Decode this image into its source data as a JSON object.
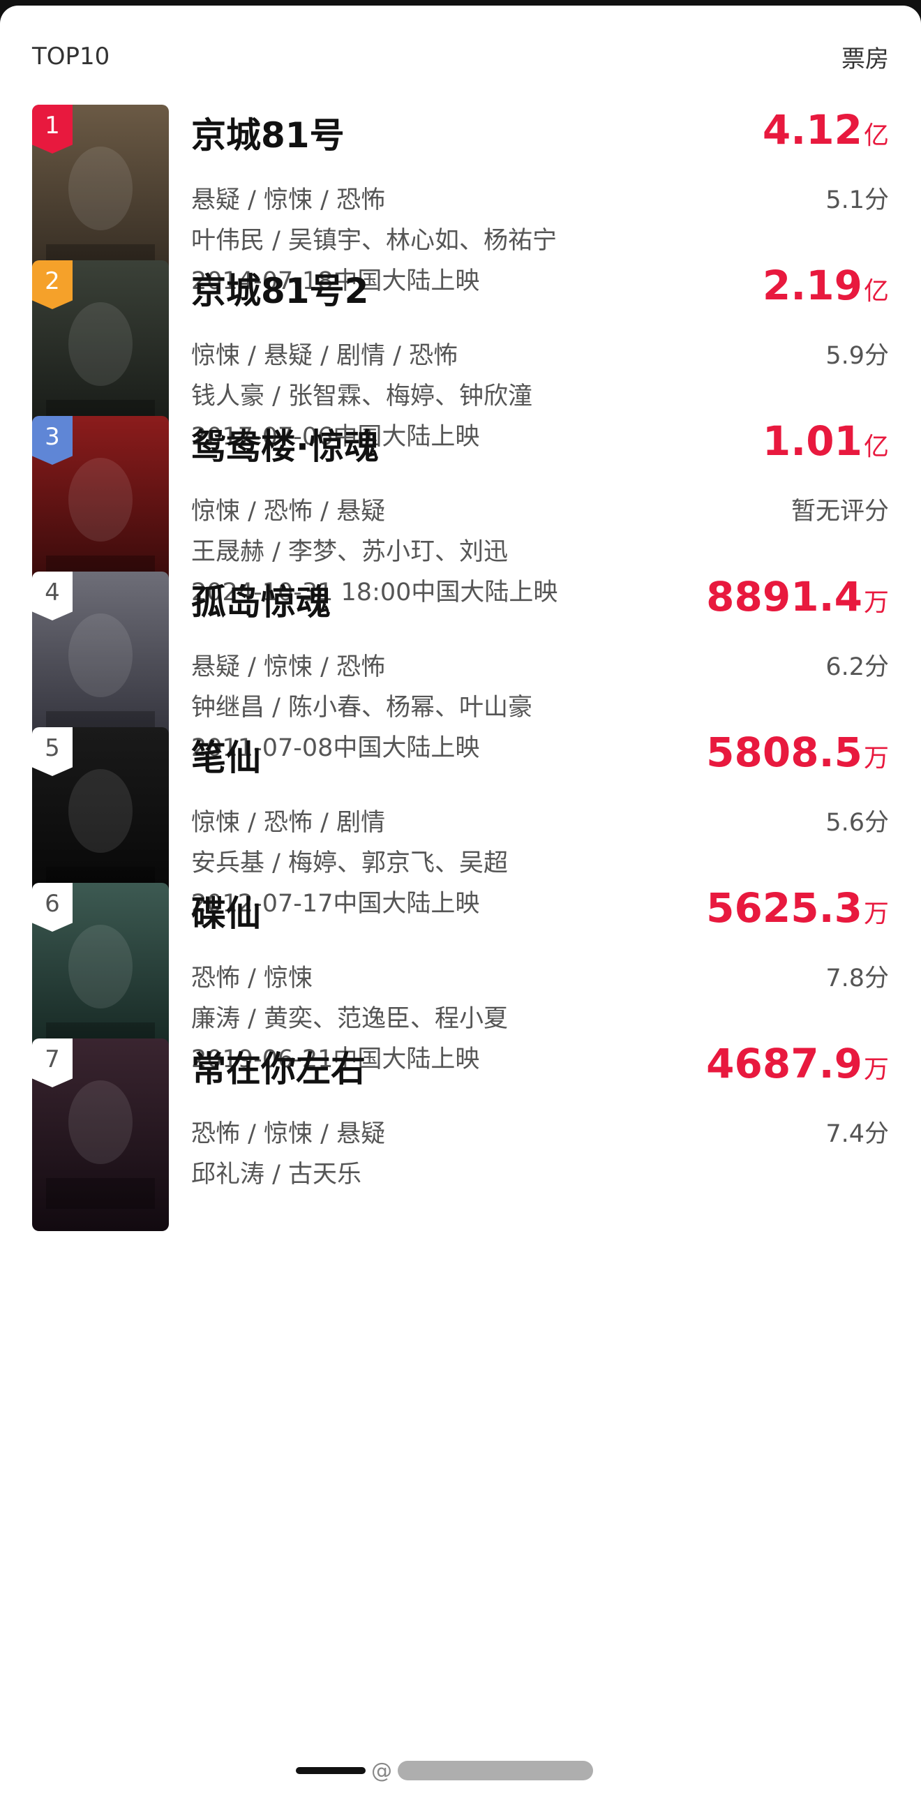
{
  "header": {
    "title": "TOP10",
    "right_label": "票房"
  },
  "movies": [
    {
      "rank": "1",
      "title": "京城81号",
      "box_num": "4.12",
      "box_unit": "亿",
      "genres": "悬疑 / 惊悚 / 恐怖",
      "score": "5.1分",
      "crew": "叶伟民 / 吴镇宇、林心如、杨祐宁",
      "release": "2014-07-18中国大陆上映",
      "poster_colors": [
        "#6b5a45",
        "#2d261e"
      ]
    },
    {
      "rank": "2",
      "title": "京城81号2",
      "box_num": "2.19",
      "box_unit": "亿",
      "genres": "惊悚 / 悬疑 / 剧情 / 恐怖",
      "score": "5.9分",
      "crew": "钱人豪 / 张智霖、梅婷、钟欣潼",
      "release": "2017-07-06中国大陆上映",
      "poster_colors": [
        "#3b4138",
        "#121512"
      ]
    },
    {
      "rank": "3",
      "title": "鸳鸯楼·惊魂",
      "box_num": "1.01",
      "box_unit": "亿",
      "genres": "惊悚 / 恐怖 / 悬疑",
      "score": "暂无评分",
      "crew": "王晟赫 / 李梦、苏小玎、刘迅",
      "release": "2024-10-31 18:00中国大陆上映",
      "poster_colors": [
        "#8c1c1c",
        "#2a0808"
      ]
    },
    {
      "rank": "4",
      "title": "孤岛惊魂",
      "box_num": "8891.4",
      "box_unit": "万",
      "genres": "悬疑 / 惊悚 / 恐怖",
      "score": "6.2分",
      "crew": "钟继昌 / 陈小春、杨幂、叶山豪",
      "release": "2011-07-08中国大陆上映",
      "poster_colors": [
        "#6e6e78",
        "#2a2a33"
      ]
    },
    {
      "rank": "5",
      "title": "笔仙",
      "box_num": "5808.5",
      "box_unit": "万",
      "genres": "惊悚 / 恐怖 / 剧情",
      "score": "5.6分",
      "crew": "安兵基 / 梅婷、郭京飞、吴超",
      "release": "2012-07-17中国大陆上映",
      "poster_colors": [
        "#1a1a1a",
        "#050505"
      ]
    },
    {
      "rank": "6",
      "title": "碟仙",
      "box_num": "5625.3",
      "box_unit": "万",
      "genres": "恐怖 / 惊悚",
      "score": "7.8分",
      "crew": "廉涛 / 黄奕、范逸臣、程小夏",
      "release": "2019-06-21中国大陆上映",
      "poster_colors": [
        "#3d5a52",
        "#10201c"
      ]
    },
    {
      "rank": "7",
      "title": "常在你左右",
      "box_num": "4687.9",
      "box_unit": "万",
      "genres": "恐怖 / 惊悚 / 悬疑",
      "score": "7.4分",
      "crew": "邱礼涛 / 古天乐",
      "release": "",
      "poster_colors": [
        "#3a2530",
        "#120a10"
      ]
    }
  ],
  "watermark": {
    "text": "@"
  }
}
